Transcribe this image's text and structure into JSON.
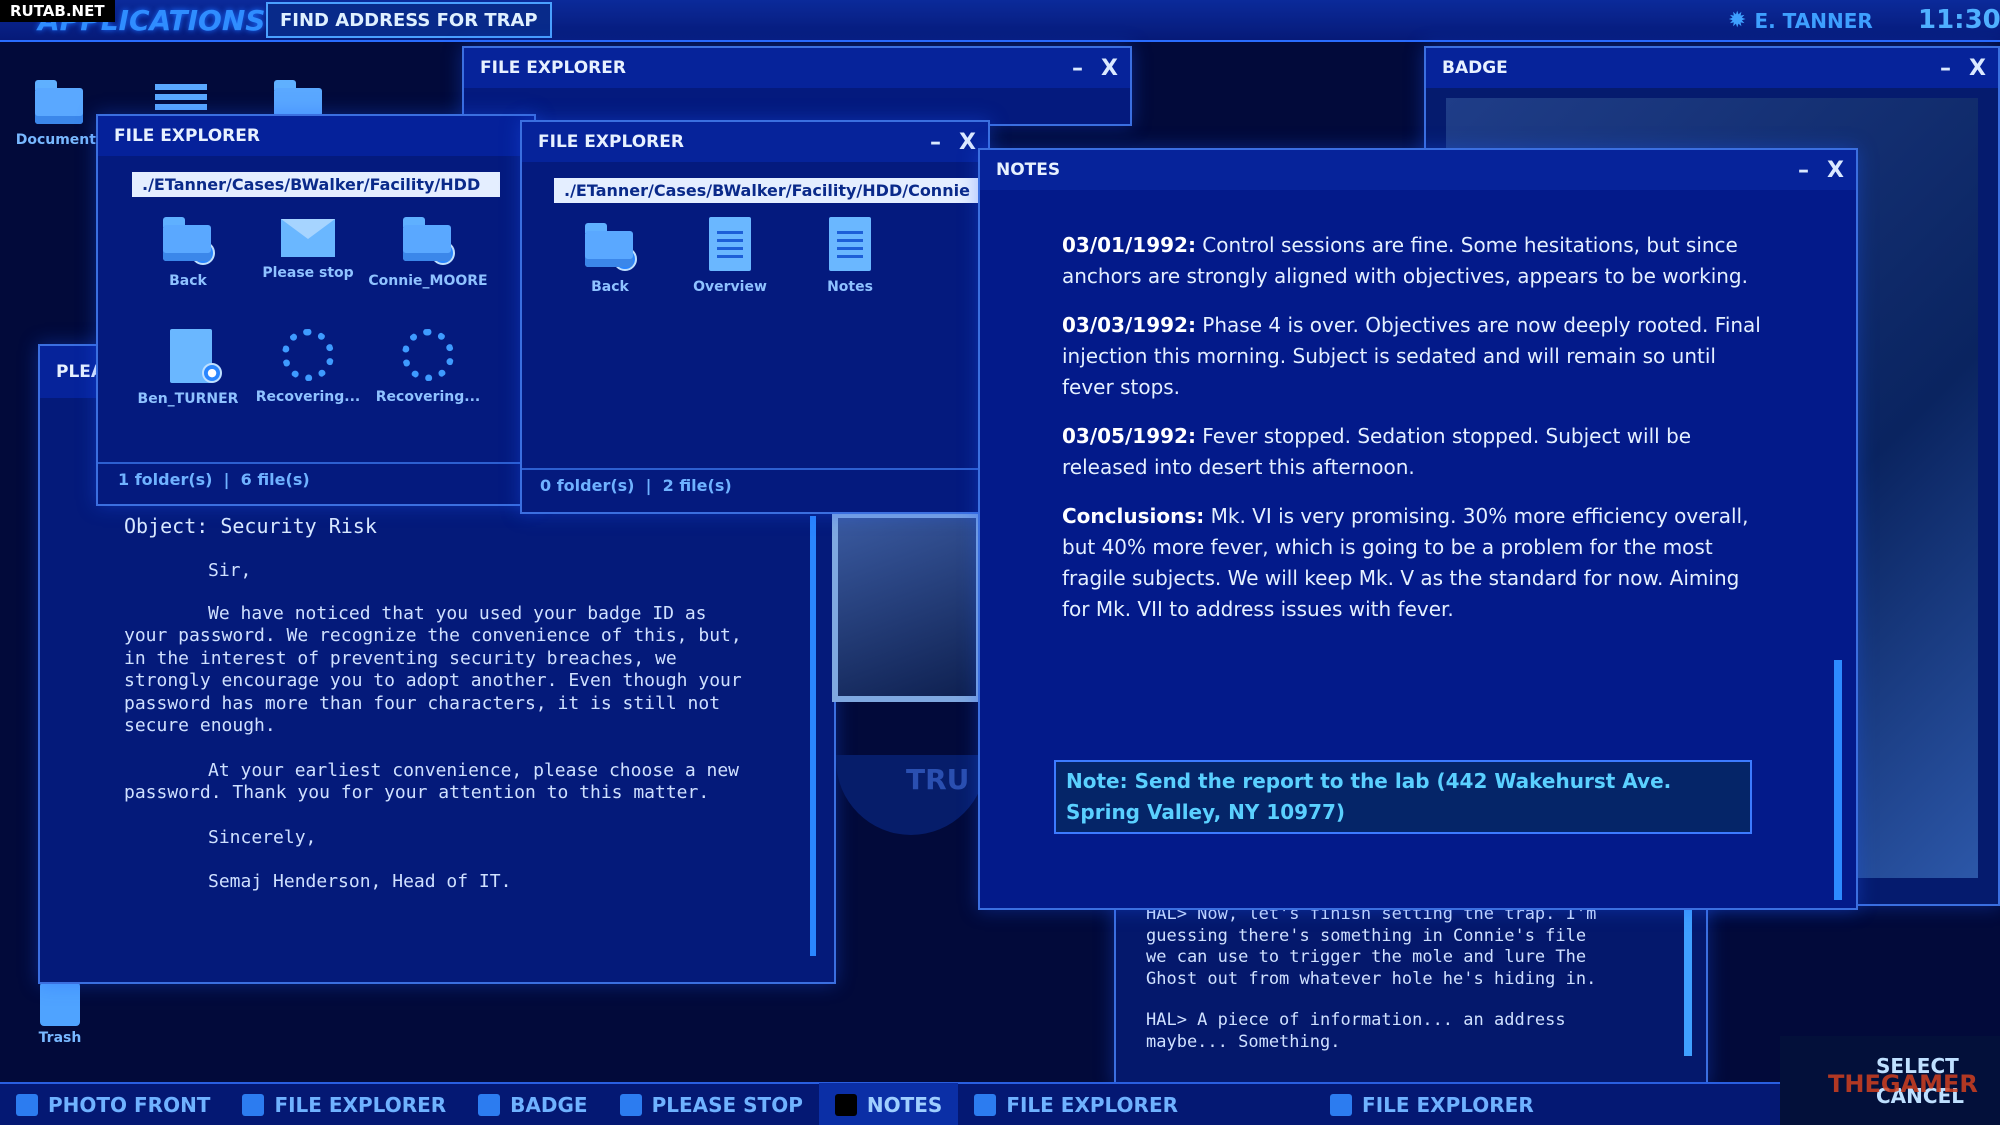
{
  "watermark": "RUTAB.NET",
  "topbar": {
    "apps_label": "APPLICATIONS",
    "objective": "FIND ADDRESS FOR TRAP",
    "user": "E. TANNER",
    "clock": "11:30"
  },
  "desktop": {
    "documents": "Documents",
    "trash": "Trash"
  },
  "explorer_back": {
    "title": "FILE EXPLORER"
  },
  "explorer1": {
    "title": "FILE EXPLORER",
    "path": "./ETanner/Cases/BWalker/Facility/HDD",
    "items": [
      {
        "label": "Back",
        "icon": "folder-back-icon"
      },
      {
        "label": "Please stop",
        "icon": "mail-icon"
      },
      {
        "label": "Connie_MOORE",
        "icon": "folder-check-icon"
      },
      {
        "label": "Ben_TURNER",
        "icon": "locked-file-icon"
      },
      {
        "label": "Recovering...",
        "icon": "loading-icon"
      },
      {
        "label": "Recovering...",
        "icon": "loading-icon"
      }
    ],
    "status_folders": "1 folder(s)",
    "status_files": "6 file(s)"
  },
  "explorer2": {
    "title": "FILE EXPLORER",
    "path": "./ETanner/Cases/BWalker/Facility/HDD/Connie",
    "items": [
      {
        "label": "Back",
        "icon": "folder-back-icon"
      },
      {
        "label": "Overview",
        "icon": "document-icon"
      },
      {
        "label": "Notes",
        "icon": "document-icon"
      }
    ],
    "status_folders": "0 folder(s)",
    "status_files": "2 file(s)"
  },
  "letter": {
    "tab": "PLEA",
    "object": "Object: Security Risk",
    "salutation": "Sir,",
    "paragraph1": "We have noticed that you used your badge ID as\nyour password. We recognize the convenience of this, but,\nin the interest of preventing security breaches, we\nstrongly encourage you to adopt another. Even though your\npassword has more than four characters, it is still not\nsecure enough.",
    "paragraph2": "At your earliest convenience, please choose a new\npassword. Thank you for your attention to this matter.",
    "closing": "Sincerely,",
    "signature": "Semaj Henderson, Head of IT."
  },
  "badge": {
    "title": "BADGE",
    "text": "TRU"
  },
  "notes": {
    "title": "NOTES",
    "entries": [
      {
        "date": "03/01/1992:",
        "text": " Control sessions are fine. Some hesitations, but since anchors are strongly aligned with objectives, appears to be working."
      },
      {
        "date": "03/03/1992:",
        "text": " Phase 4 is over. Objectives are now deeply rooted. Final injection this morning. Subject is sedated and will remain so until fever stops."
      },
      {
        "date": "03/05/1992:",
        "text": " Fever stopped. Sedation stopped. Subject will be released into desert this afternoon."
      },
      {
        "date": "Conclusions:",
        "text": " Mk. VI is very promising. 30% more efficiency overall, but 40% more fever, which is going to be a problem for the most fragile subjects. We will keep Mk. V as the standard for now. Aiming for Mk. VII to address issues with fever."
      }
    ],
    "highlight": "Note: Send the report to the lab (442 Wakehurst Ave.\nSpring Valley, NY 10977)"
  },
  "chat": {
    "line1": "HAL> Now, let's finish setting the trap. I'm\nguessing there's something in Connie's file\nwe can use to trigger the mole and lure The\nGhost out from whatever hole he's hiding in.",
    "line2": "HAL> A piece of information... an address\nmaybe... Something."
  },
  "taskbar": [
    "PHOTO FRONT",
    "FILE EXPLORER",
    "BADGE",
    "PLEASE STOP",
    "NOTES",
    "FILE EXPLORER",
    "FILE EXPLORER"
  ],
  "controls": {
    "select": "SELECT",
    "cancel": "CANCEL",
    "brand": "THEGAMER"
  }
}
